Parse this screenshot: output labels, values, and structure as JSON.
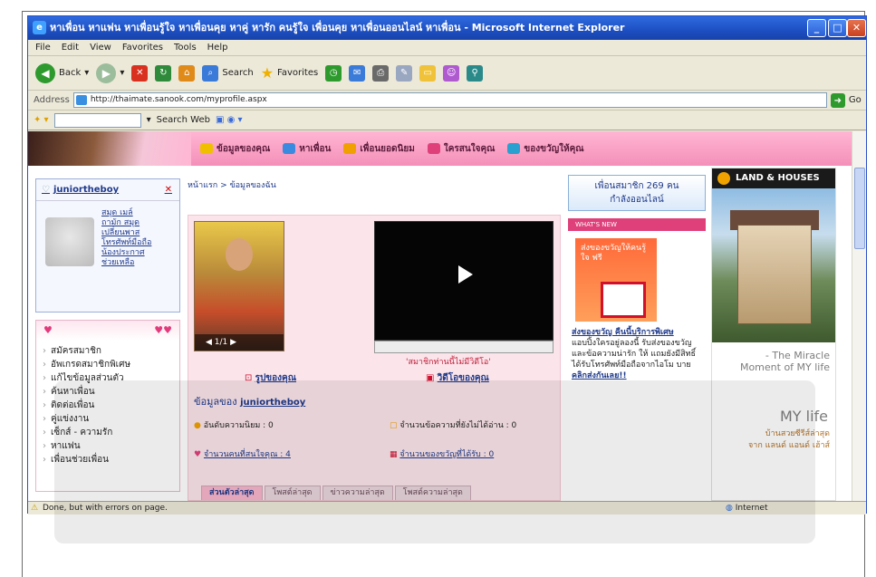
{
  "window": {
    "title": "หาเพื่อน หาแฟน หาเพื่อนรู้ใจ หาเพื่อนคุย หาคู่ หารัก คนรู้ใจ เพื่อนคุย หาเพื่อนออนไลน์ หาเพื่อน - Microsoft Internet Explorer"
  },
  "menu": [
    "File",
    "Edit",
    "View",
    "Favorites",
    "Tools",
    "Help"
  ],
  "toolbar": {
    "back": "Back",
    "search": "Search",
    "favorites": "Favorites"
  },
  "address": {
    "label": "Address",
    "url": "http://thaimate.sanook.com/myprofile.aspx",
    "go": "Go"
  },
  "searchbar": {
    "label": "Search Web"
  },
  "nav": {
    "items": [
      "ข้อมูลของคุณ",
      "หาเพื่อน",
      "เพื่อนยอดนิยม",
      "ใครสนใจคุณ",
      "ของขวัญให้คุณ"
    ]
  },
  "user": {
    "name": "juniortheboy",
    "links": [
      "สมุด เมล์",
      "ถามัก สมุด",
      "เปลี่ยนพาส",
      "โทรศัพท์มือถือ",
      "น้องประกาศ",
      "ช่วยเหลือ"
    ]
  },
  "sidemenu": [
    "สมัครสมาชิก",
    "อัพเกรดสมาชิกพิเศษ",
    "แก้ไขข้อมูลส่วนตัว",
    "ค้นหาเพื่อน",
    "ติดต่อเพื่อน",
    "คู่แข่งงาน",
    "เซ็กส์ - ความรัก",
    "หาแฟน",
    "เพื่อนช่วยเพื่อน"
  ],
  "breadcrumb": "หน้าแรก > ข้อมูลของฉัน",
  "profile": {
    "photo_counter": "1/1",
    "video_note": "'สมาชิกท่านนี้ไม่มีวิดีโอ'",
    "photo_link": "รูปของคุณ",
    "video_link": "วิดีโอของคุณ",
    "info_label": "ข้อมูลของ",
    "info_name": "juniortheboy",
    "rank_label": "อันดับความนิยม : 0",
    "unread_label": "จำนวนข้อความที่ยังไม่ได้อ่าน : 0",
    "interest_label": "จำนวนคนที่สนใจคุณ : 4",
    "gifts_label": "จำนวนของขวัญที่ได้รับ : 0",
    "tabs": [
      "ส่วนตัวล่าสุด",
      "โพสต์ล่าสุด",
      "ข่าวความล่าสุด",
      "โพสต์ความล่าสุด"
    ]
  },
  "right": {
    "online": "เพื่อนสมาชิก 269 คน",
    "online2": "กำลังออนไลน์",
    "whatsnew": "WHAT'S NEW",
    "gift_img_text": "ส่งของขวัญให้คนรู้ใจ ฟรี",
    "gift_title": "ส่งของขวัญ คืนนี้บริการพิเศษ",
    "gift_body": "แอบปิ้งใครอยู่ลองนี้ รับส่งของขวัญและข้อความน่ารัก ให้ แถมยังมีสิทธิ์ได้รับโทรศัพท์มือถือจากไอโม บาย",
    "gift_link": "คลิกส่งกันเลย!!"
  },
  "ad": {
    "brand": "LAND & HOUSES",
    "line1": "- The Miracle",
    "line2": "Moment of MY life",
    "logo": "MY life",
    "line3": "บ้านสวยซีรีส์ล่าสุด",
    "line4": "จาก แลนด์ แอนด์ เฮ้าส์"
  },
  "status": {
    "text": "Done, but with errors on page.",
    "zone": "Internet"
  }
}
